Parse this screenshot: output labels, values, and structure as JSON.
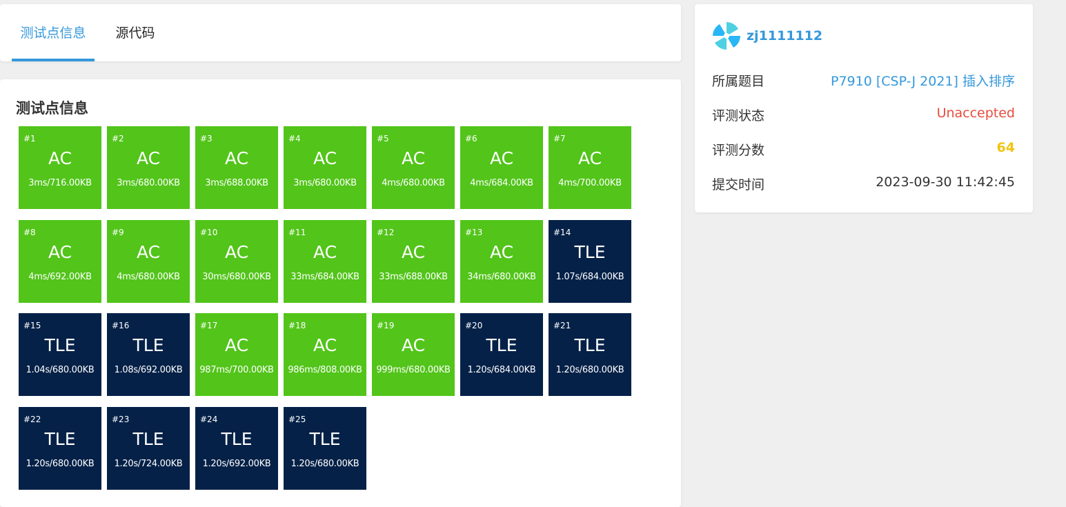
{
  "tabs": [
    {
      "label": "测试点信息",
      "active": true
    },
    {
      "label": "源代码",
      "active": false
    }
  ],
  "cases_title": "测试点信息",
  "colors": {
    "accent": "#3498db",
    "ac": "#52c41a",
    "tle": "#052148",
    "unaccepted": "#e74c3c",
    "score": "#f1c40f"
  },
  "test_cases": [
    {
      "id": "#1",
      "status": "AC",
      "info": "3ms/716.00KB"
    },
    {
      "id": "#2",
      "status": "AC",
      "info": "3ms/680.00KB"
    },
    {
      "id": "#3",
      "status": "AC",
      "info": "3ms/688.00KB"
    },
    {
      "id": "#4",
      "status": "AC",
      "info": "3ms/680.00KB"
    },
    {
      "id": "#5",
      "status": "AC",
      "info": "4ms/680.00KB"
    },
    {
      "id": "#6",
      "status": "AC",
      "info": "4ms/684.00KB"
    },
    {
      "id": "#7",
      "status": "AC",
      "info": "4ms/700.00KB"
    },
    {
      "id": "#8",
      "status": "AC",
      "info": "4ms/692.00KB"
    },
    {
      "id": "#9",
      "status": "AC",
      "info": "4ms/680.00KB"
    },
    {
      "id": "#10",
      "status": "AC",
      "info": "30ms/680.00KB"
    },
    {
      "id": "#11",
      "status": "AC",
      "info": "33ms/684.00KB"
    },
    {
      "id": "#12",
      "status": "AC",
      "info": "33ms/688.00KB"
    },
    {
      "id": "#13",
      "status": "AC",
      "info": "34ms/680.00KB"
    },
    {
      "id": "#14",
      "status": "TLE",
      "info": "1.07s/684.00KB"
    },
    {
      "id": "#15",
      "status": "TLE",
      "info": "1.04s/680.00KB"
    },
    {
      "id": "#16",
      "status": "TLE",
      "info": "1.08s/692.00KB"
    },
    {
      "id": "#17",
      "status": "AC",
      "info": "987ms/700.00KB"
    },
    {
      "id": "#18",
      "status": "AC",
      "info": "986ms/808.00KB"
    },
    {
      "id": "#19",
      "status": "AC",
      "info": "999ms/680.00KB"
    },
    {
      "id": "#20",
      "status": "TLE",
      "info": "1.20s/684.00KB"
    },
    {
      "id": "#21",
      "status": "TLE",
      "info": "1.20s/680.00KB"
    },
    {
      "id": "#22",
      "status": "TLE",
      "info": "1.20s/680.00KB"
    },
    {
      "id": "#23",
      "status": "TLE",
      "info": "1.20s/724.00KB"
    },
    {
      "id": "#24",
      "status": "TLE",
      "info": "1.20s/692.00KB"
    },
    {
      "id": "#25",
      "status": "TLE",
      "info": "1.20s/680.00KB"
    }
  ],
  "user": {
    "name": "zj1111112",
    "avatar_icon": "avatar-pinwheel-icon"
  },
  "info": {
    "problem_label": "所属题目",
    "problem_value": "P7910 [CSP-J 2021] 插入排序",
    "status_label": "评测状态",
    "status_value": "Unaccepted",
    "score_label": "评测分数",
    "score_value": "64",
    "time_label": "提交时间",
    "time_value": "2023-09-30 11:42:45"
  }
}
